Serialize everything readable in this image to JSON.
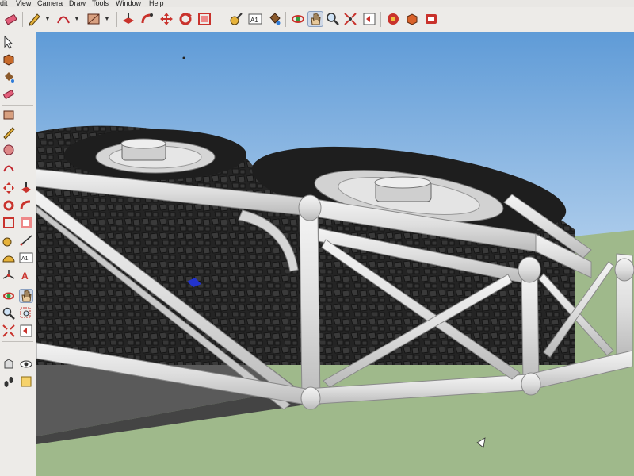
{
  "menu": {
    "items": [
      {
        "label": "dit"
      },
      {
        "label": "View"
      },
      {
        "label": "Camera"
      },
      {
        "label": "Draw"
      },
      {
        "label": "Tools"
      },
      {
        "label": "Window"
      },
      {
        "label": "Help"
      }
    ]
  },
  "toolbar": {
    "icons": [
      "eraser-icon",
      "pencil-icon",
      "arc-icon",
      "rectangle-icon",
      "push-pull-icon",
      "follow-me-icon",
      "move-icon",
      "rotate-icon",
      "scale-icon",
      "tape-measure-icon",
      "text-icon",
      "paint-bucket-icon",
      "orbit-icon",
      "pan-icon",
      "zoom-icon",
      "zoom-extents-icon",
      "previous-view-icon",
      "3d-warehouse-icon",
      "components-icon",
      "extension-icon"
    ],
    "active": "pan-icon",
    "text_tool_glyph": "A1"
  },
  "lefttool": {
    "text_tool_glyph": "A1"
  },
  "colors": {
    "sky_top": "#5f9bd7",
    "sky_bottom": "#dbe8f4",
    "ground": "#9fb98b",
    "frame": "#dcdcdc",
    "tire": "#2b2b2b"
  }
}
